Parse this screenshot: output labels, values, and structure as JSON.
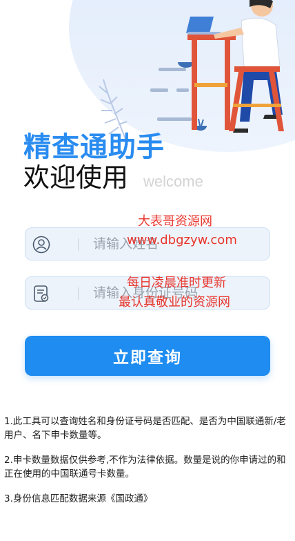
{
  "header": {
    "title": "精查通助手",
    "subtitle": "欢迎使用",
    "welcome": "welcome"
  },
  "form": {
    "name_placeholder": "请输入姓名",
    "id_placeholder": "请输入身份证号码",
    "submit_label": "立即查询"
  },
  "watermark": {
    "line1": "大表哥资源网",
    "line2": "www.dbgzyw.com",
    "line3": "每日凌晨准时更新",
    "line4": "最认真敬业的资源网"
  },
  "notes": [
    "1.此工具可以查询姓名和身份证号码是否匹配、是否为中国联通新/老用户、名下申卡数量等。",
    "2.申卡数量数据仅供参考,不作为法律依据。数量是说的你申请过的和正在使用的中国联通号卡数量。",
    "3.身份信息匹配数据来源《国政通》"
  ],
  "colors": {
    "accent": "#1e8cf0",
    "title_blue": "#2a8cf0",
    "watermark_red": "#e8352c"
  },
  "icons": {
    "name_field": "user-icon",
    "id_field": "id-card-icon"
  }
}
